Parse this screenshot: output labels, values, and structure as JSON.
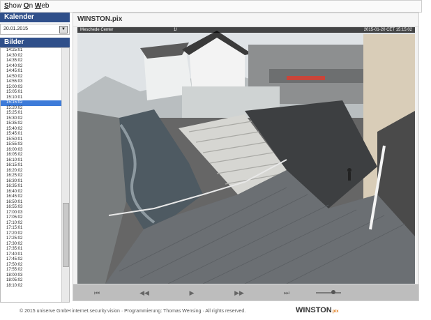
{
  "header": {
    "brand_s": "S",
    "brand_rest1": "how ",
    "brand_o": "O",
    "brand_rest2": "n ",
    "brand_w": "W",
    "brand_rest3": "eb"
  },
  "sidebar": {
    "calendar_label": "Kalender",
    "date_value": "20.01.2015",
    "images_label": "Bilder",
    "times": [
      "14:25:01",
      "14:30:02",
      "14:35:02",
      "14:40:02",
      "14:45:01",
      "14:50:02",
      "14:55:03",
      "15:00:03",
      "15:05:01",
      "15:10:01",
      "15:15:02",
      "15:20:02",
      "15:25:01",
      "15:30:02",
      "15:35:02",
      "15:40:02",
      "15:45:01",
      "15:50:01",
      "15:55:03",
      "16:00:03",
      "16:05:02",
      "16:10:01",
      "16:15:01",
      "16:20:02",
      "16:25:02",
      "16:30:01",
      "16:35:01",
      "16:40:02",
      "16:45:02",
      "16:50:01",
      "16:55:03",
      "17:00:03",
      "17:05:02",
      "17:10:02",
      "17:15:01",
      "17:20:02",
      "17:25:02",
      "17:30:02",
      "17:35:01",
      "17:40:01",
      "17:45:02",
      "17:50:02",
      "17:55:02",
      "18:00:03",
      "18:05:02",
      "18:10:02"
    ],
    "selected_time": "15:15:02"
  },
  "viewer": {
    "title": "WINSTON.pix",
    "overlay_left": "Meschede Center",
    "overlay_mid": "1/",
    "overlay_right": "2015-01-20 CET 15:15:02",
    "controls": {
      "first": "⏮",
      "prev": "◀◀",
      "play": "▶",
      "next": "▶▶",
      "last": "⏭"
    }
  },
  "footer": {
    "copyright": "© 2015 uniserve GmbH internet.security.vision · Programmierung: Thomas Wensing · All rights reserved.",
    "logo_text": "WINSTON",
    "logo_sub": "pix"
  },
  "colors": {
    "header_bg": "#2f4f8a",
    "selection_bg": "#3d7bd9",
    "logo_accent": "#e07b1a"
  }
}
